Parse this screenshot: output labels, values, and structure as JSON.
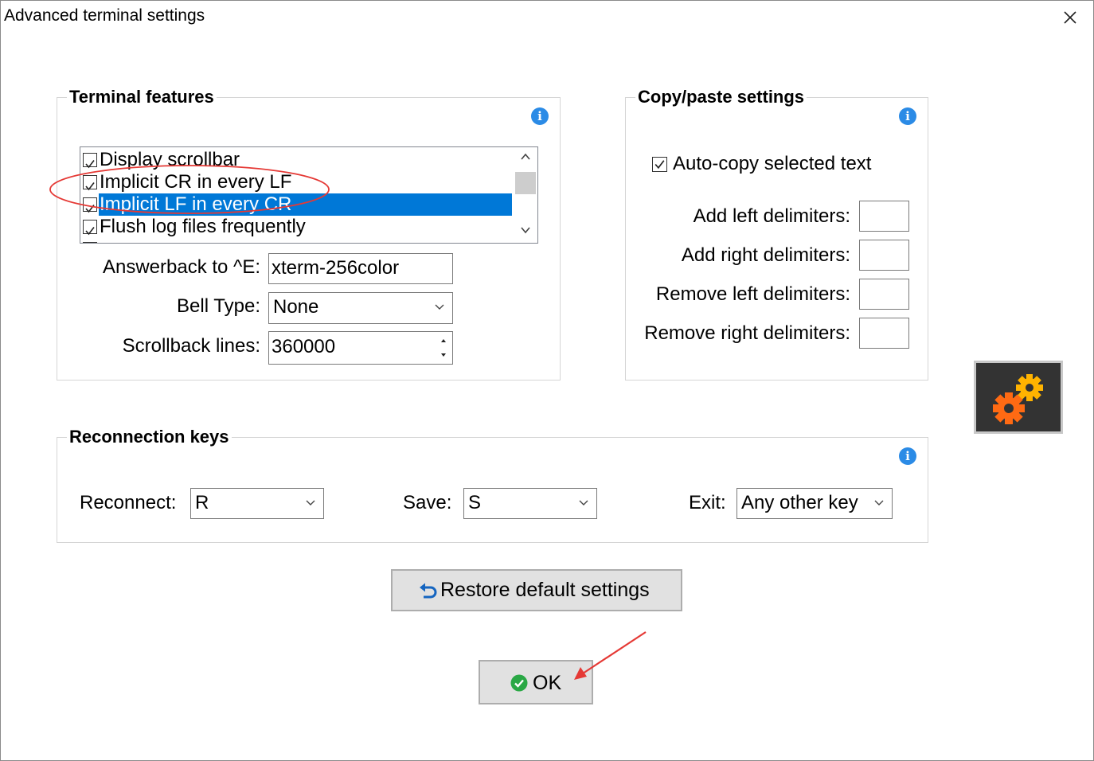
{
  "window": {
    "title": "Advanced terminal settings"
  },
  "icons": {
    "close": "close-icon",
    "info": "info-icon",
    "restore": "undo-arrow-icon",
    "ok": "check-circle-icon",
    "gears": "gears-icon"
  },
  "colors": {
    "selection": "#0078d7",
    "info": "#2b8be6",
    "ok_green": "#2aa845",
    "annotation_red": "#e53935",
    "gear_orange": "#ff6a13",
    "gear_yellow": "#ffb300"
  },
  "terminal_features": {
    "title": "Terminal features",
    "list_items": [
      {
        "label": "Display scrollbar",
        "checked": true,
        "selected": false
      },
      {
        "label": "Implicit CR in every LF",
        "checked": true,
        "selected": false
      },
      {
        "label": "Implicit LF in every CR",
        "checked": true,
        "selected": true
      },
      {
        "label": "Flush log files frequently",
        "checked": true,
        "selected": false
      }
    ],
    "answerback_label": "Answerback to ^E:",
    "answerback_value": "xterm-256color",
    "bell_label": "Bell Type:",
    "bell_value": "None",
    "scrollback_label": "Scrollback lines:",
    "scrollback_value": "360000"
  },
  "copy_paste": {
    "title": "Copy/paste settings",
    "autocopy_label": "Auto-copy selected text",
    "autocopy_checked": true,
    "add_left_label": "Add left delimiters:",
    "add_left_value": "",
    "add_right_label": "Add right delimiters:",
    "add_right_value": "",
    "remove_left_label": "Remove left delimiters:",
    "remove_left_value": "",
    "remove_right_label": "Remove right delimiters:",
    "remove_right_value": ""
  },
  "reconnection": {
    "title": "Reconnection keys",
    "reconnect_label": "Reconnect:",
    "reconnect_value": "R",
    "save_label": "Save:",
    "save_value": "S",
    "exit_label": "Exit:",
    "exit_value": "Any other key"
  },
  "buttons": {
    "restore": "Restore default settings",
    "ok": "OK"
  }
}
